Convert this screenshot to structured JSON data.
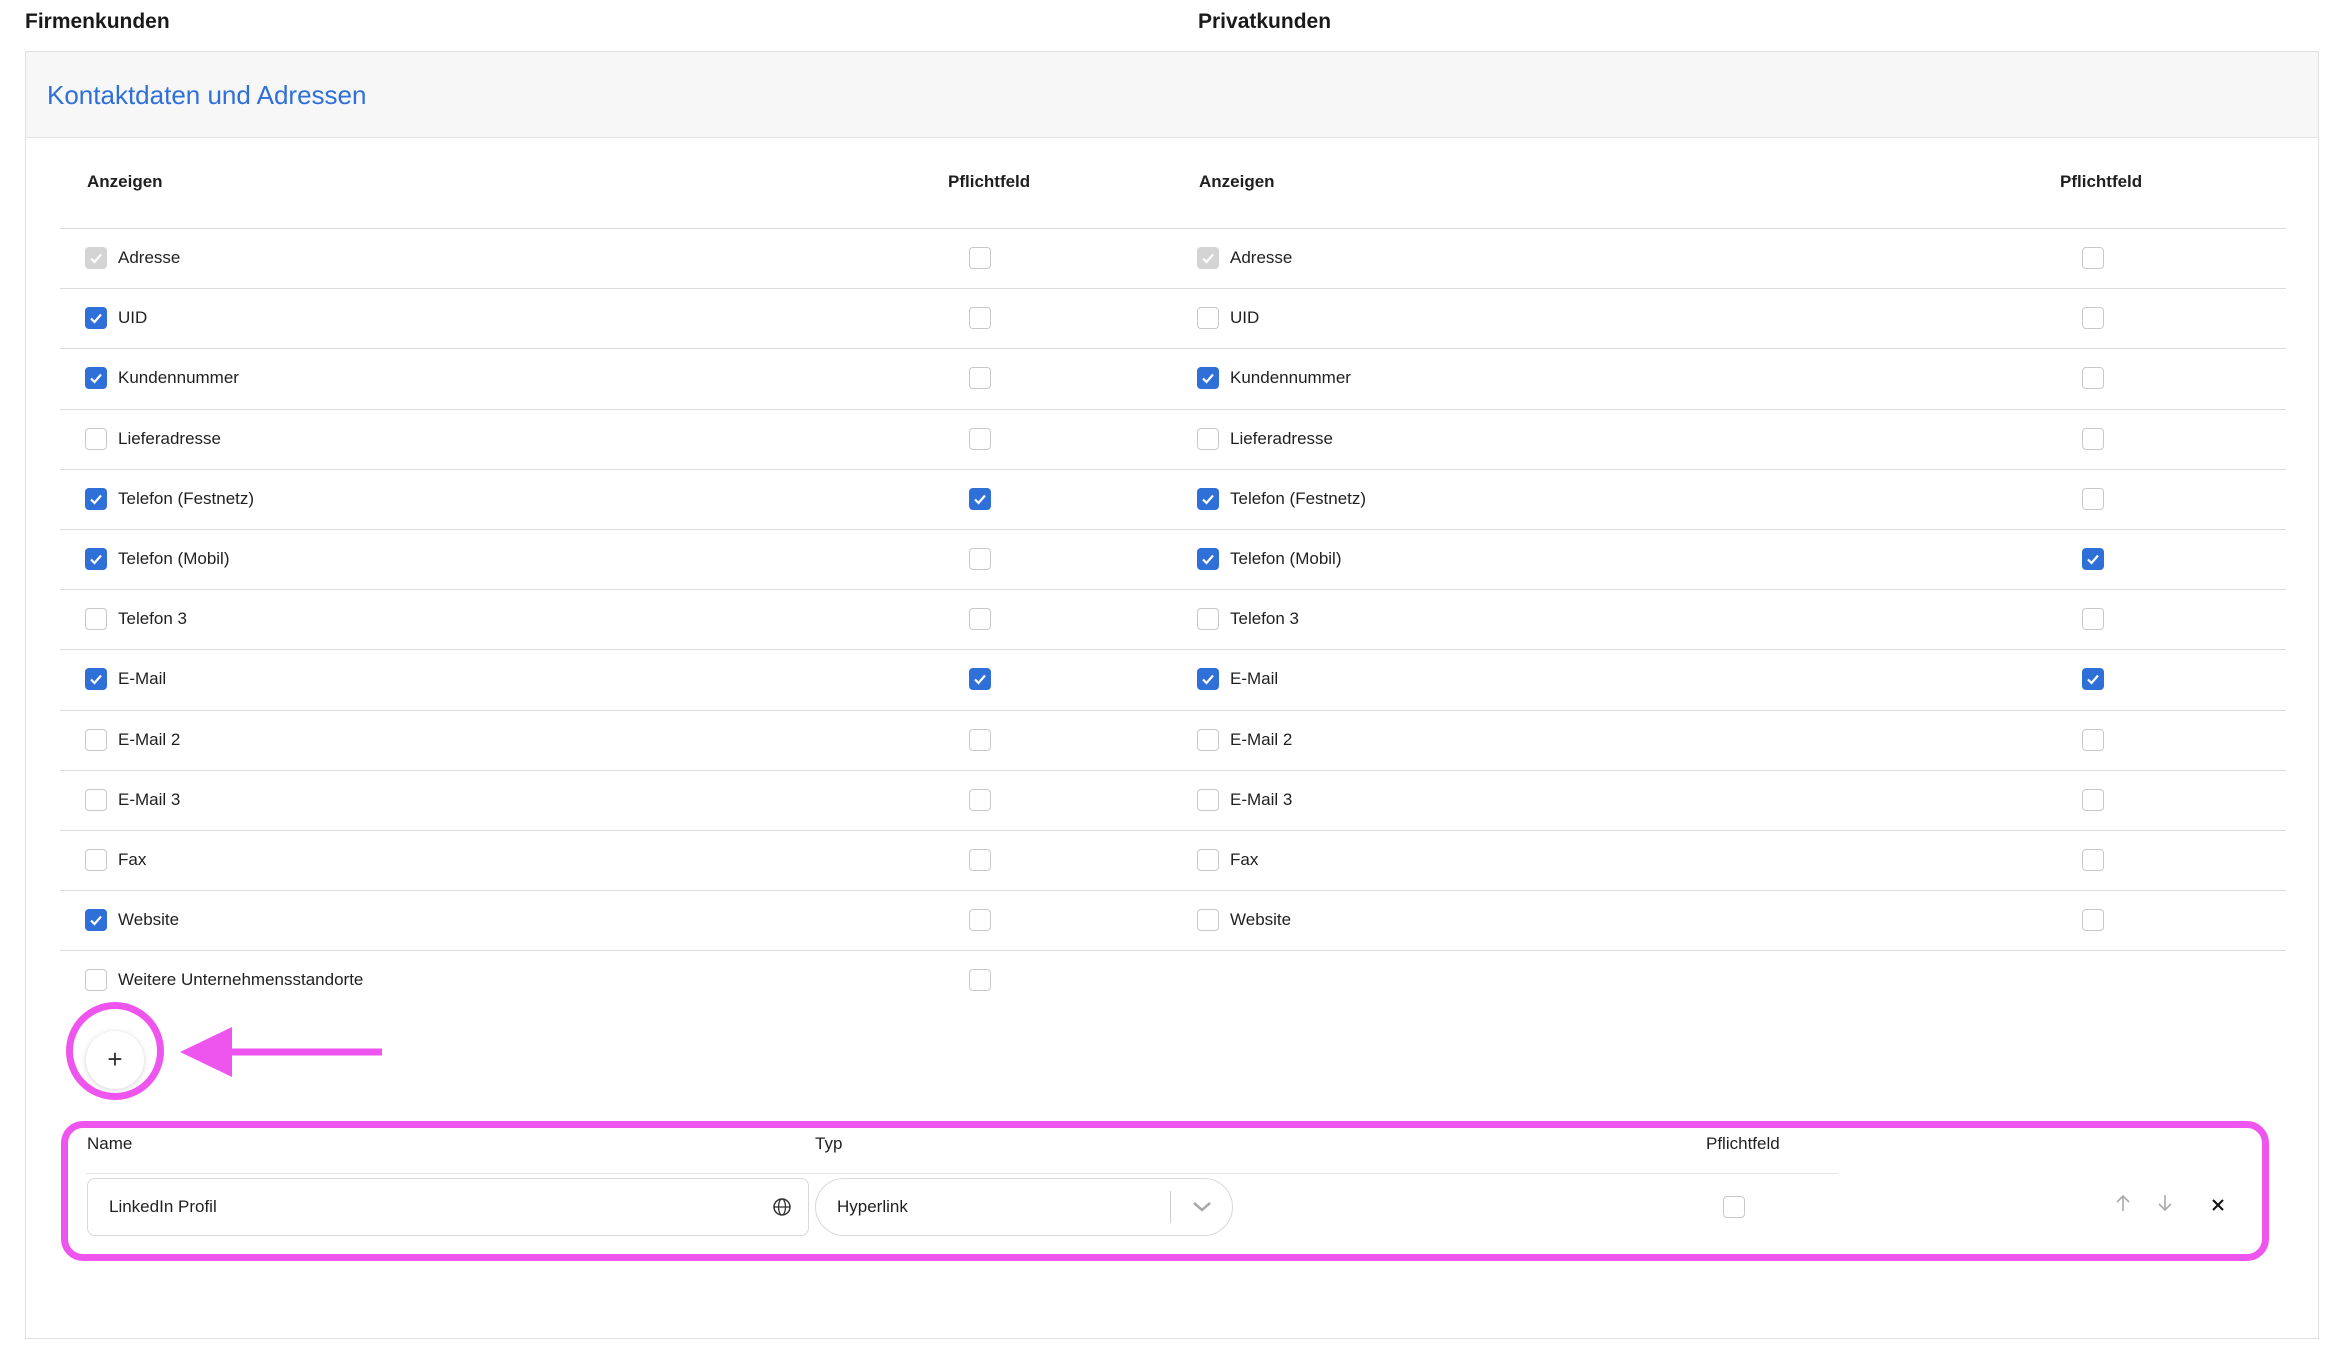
{
  "headings": {
    "firmenkunden": "Firmenkunden",
    "privatkunden": "Privatkunden"
  },
  "section": {
    "title": "Kontaktdaten und Adressen"
  },
  "columns": {
    "left_show": "Anzeigen",
    "left_required": "Pflichtfeld",
    "right_show": "Anzeigen",
    "right_required": "Pflichtfeld"
  },
  "firmen_rows": [
    {
      "label": "Adresse",
      "show": "disabled",
      "required": "off"
    },
    {
      "label": "UID",
      "show": "on",
      "required": "off"
    },
    {
      "label": "Kundennummer",
      "show": "on",
      "required": "off"
    },
    {
      "label": "Lieferadresse",
      "show": "off",
      "required": "off"
    },
    {
      "label": "Telefon (Festnetz)",
      "show": "on",
      "required": "on"
    },
    {
      "label": "Telefon (Mobil)",
      "show": "on",
      "required": "off"
    },
    {
      "label": "Telefon 3",
      "show": "off",
      "required": "off"
    },
    {
      "label": "E-Mail",
      "show": "on",
      "required": "on"
    },
    {
      "label": "E-Mail 2",
      "show": "off",
      "required": "off"
    },
    {
      "label": "E-Mail 3",
      "show": "off",
      "required": "off"
    },
    {
      "label": "Fax",
      "show": "off",
      "required": "off"
    },
    {
      "label": "Website",
      "show": "on",
      "required": "off"
    },
    {
      "label": "Weitere Unternehmensstandorte",
      "show": "off",
      "required": "off"
    }
  ],
  "privat_rows": [
    {
      "label": "Adresse",
      "show": "disabled",
      "required": "off"
    },
    {
      "label": "UID",
      "show": "off",
      "required": "off"
    },
    {
      "label": "Kundennummer",
      "show": "on",
      "required": "off"
    },
    {
      "label": "Lieferadresse",
      "show": "off",
      "required": "off"
    },
    {
      "label": "Telefon (Festnetz)",
      "show": "on",
      "required": "off"
    },
    {
      "label": "Telefon (Mobil)",
      "show": "on",
      "required": "on"
    },
    {
      "label": "Telefon 3",
      "show": "off",
      "required": "off"
    },
    {
      "label": "E-Mail",
      "show": "on",
      "required": "on"
    },
    {
      "label": "E-Mail 2",
      "show": "off",
      "required": "off"
    },
    {
      "label": "E-Mail 3",
      "show": "off",
      "required": "off"
    },
    {
      "label": "Fax",
      "show": "off",
      "required": "off"
    },
    {
      "label": "Website",
      "show": "off",
      "required": "off"
    }
  ],
  "add_button": {
    "label": "+"
  },
  "custom_field": {
    "name_header": "Name",
    "type_header": "Typ",
    "required_header": "Pflichtfeld",
    "name_value": "LinkedIn Profil",
    "type_value": "Hyperlink",
    "required": "off"
  },
  "colors": {
    "accent": "#2f6fd8",
    "annotation": "#ee55ee"
  }
}
